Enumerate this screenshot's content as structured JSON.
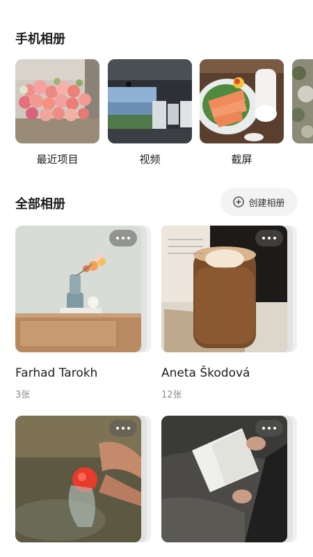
{
  "phone_albums": {
    "title": "手机相册",
    "items": [
      {
        "label": "最近项目"
      },
      {
        "label": "视频"
      },
      {
        "label": "截屏"
      },
      {
        "label": ""
      }
    ]
  },
  "all_albums": {
    "title": "全部相册",
    "create_label": "创建相册",
    "items": [
      {
        "name": "Farhad Tarokh",
        "count": "3张"
      },
      {
        "name": "Aneta Škodová",
        "count": "12张"
      },
      {
        "name": "",
        "count": ""
      },
      {
        "name": "",
        "count": ""
      }
    ]
  },
  "icons": {
    "create": "plus-circle-icon",
    "more": "more-dots-icon"
  },
  "colors": {
    "background": "#ffffff",
    "button_bg": "#f3f3f3",
    "secondary_text": "#8a8a8a"
  }
}
